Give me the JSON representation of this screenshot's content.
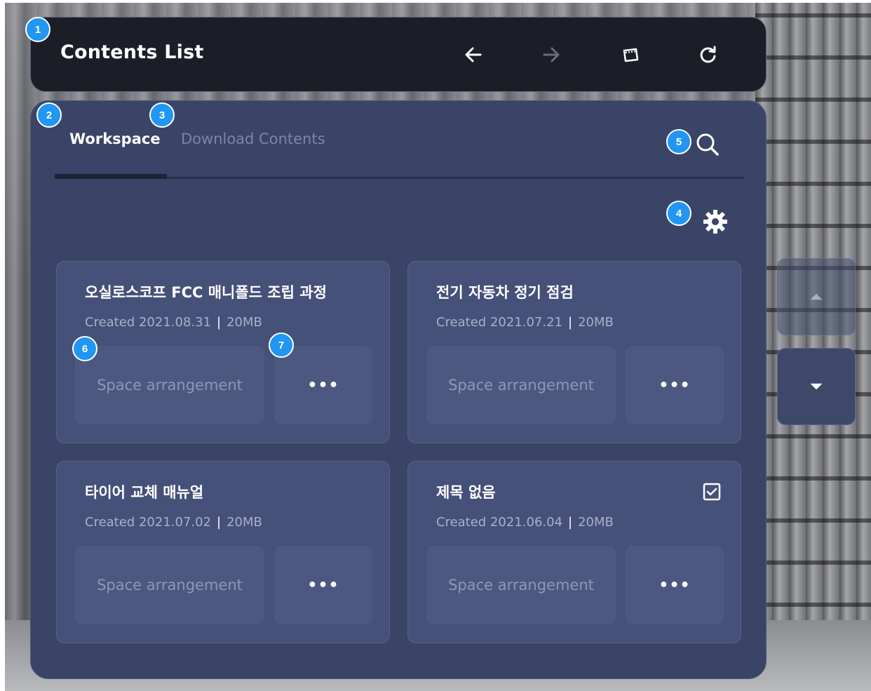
{
  "header": {
    "title": "Contents List",
    "icons": [
      "arrow-left-icon",
      "arrow-right-icon",
      "window-icon",
      "refresh-icon"
    ]
  },
  "tabs": {
    "workspace": "Workspace",
    "download": "Download Contents"
  },
  "cards": [
    {
      "title": "오실로스코프 FCC 매니폴드 조립 과정",
      "created": "Created 2021.08.31",
      "size": "20MB",
      "arrange_label": "Space arrangement",
      "more_label": "•••",
      "checked": false
    },
    {
      "title": "전기 자동차 정기 점검",
      "created": "Created 2021.07.21",
      "size": "20MB",
      "arrange_label": "Space arrangement",
      "more_label": "•••",
      "checked": false
    },
    {
      "title": "타이어 교체 매뉴얼",
      "created": "Created 2021.07.02",
      "size": "20MB",
      "arrange_label": "Space arrangement",
      "more_label": "•••",
      "checked": false
    },
    {
      "title": "제목 없음",
      "created": "Created 2021.06.04",
      "size": "20MB",
      "arrange_label": "Space arrangement",
      "more_label": "•••",
      "checked": true
    }
  ],
  "separator": "|",
  "badges": [
    "1",
    "2",
    "3",
    "4",
    "5",
    "6",
    "7"
  ],
  "colors": {
    "header_bg": "#1c1e27",
    "panel_bg": "#3a4466",
    "card_bg": "#46517a",
    "badge": "#2196f3"
  }
}
